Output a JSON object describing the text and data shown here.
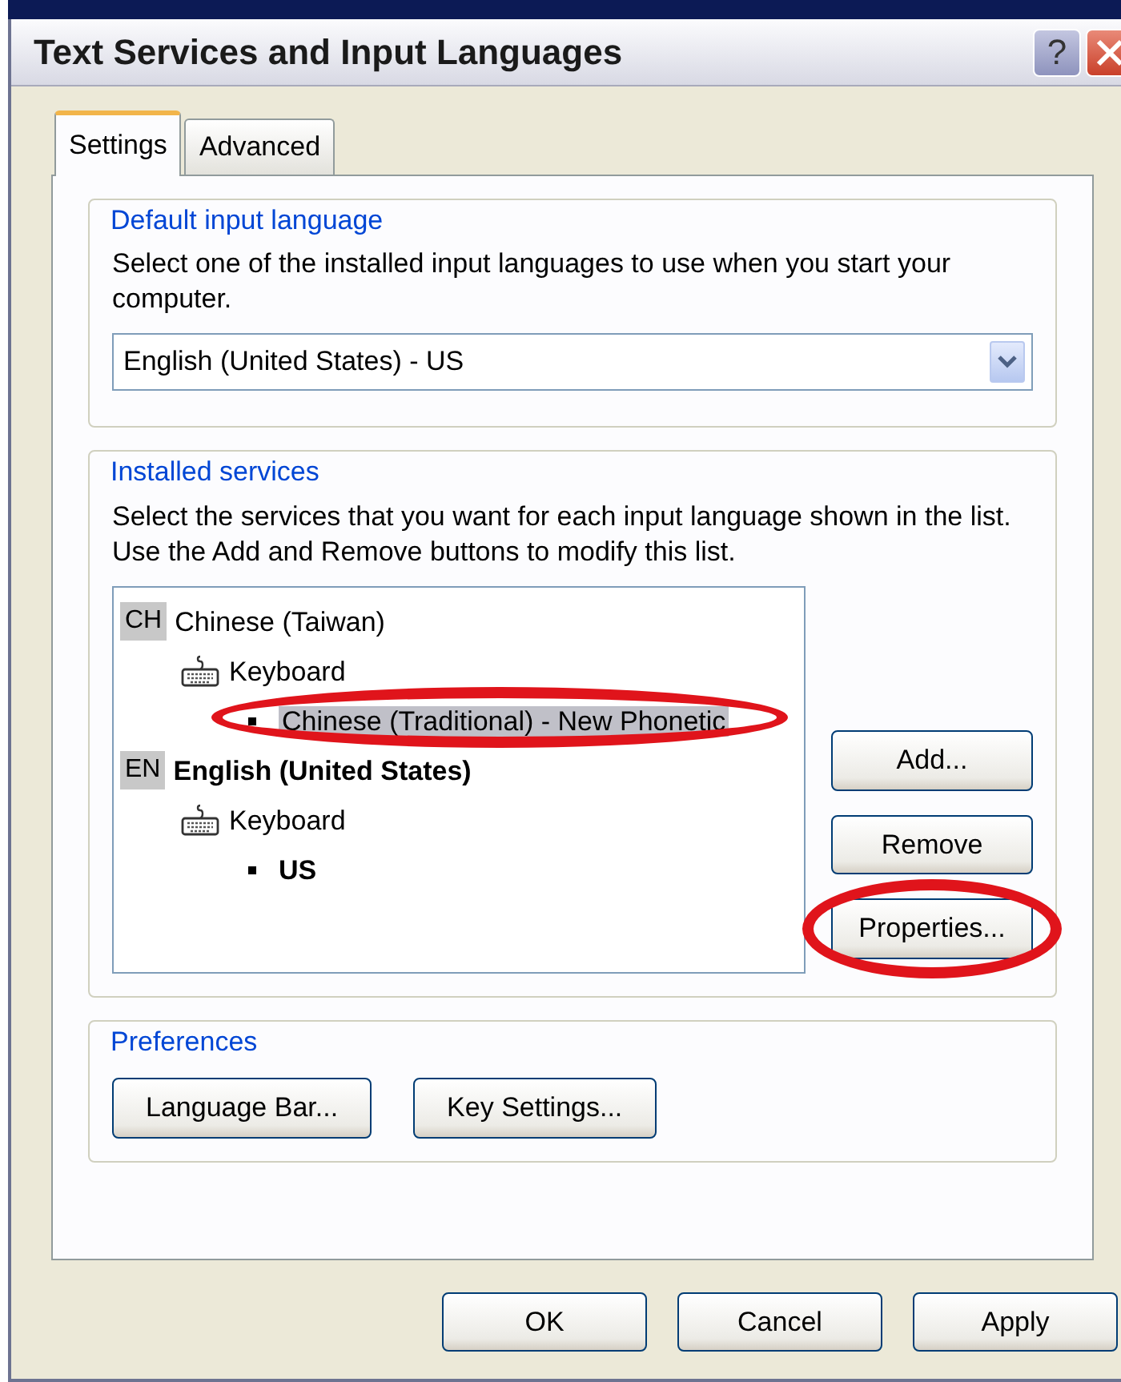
{
  "window": {
    "title": "Text Services and Input Languages",
    "title_buttons": [
      "?"
    ]
  },
  "tabs": [
    {
      "label": "Settings",
      "selected": true
    },
    {
      "label": "Advanced",
      "selected": false
    }
  ],
  "default_language": {
    "legend": "Default input language",
    "description": "Select one of the installed input languages to use when you start your computer.",
    "value": "English (United States) - US"
  },
  "installed_services": {
    "legend": "Installed services",
    "description": "Select the services that you want for each input language shown in the list. Use the Add and Remove buttons to modify this list.",
    "tree": [
      {
        "code": "CH",
        "label": "Chinese (Taiwan)",
        "default": false,
        "children": [
          {
            "label": "Keyboard",
            "children": [
              {
                "label": "Chinese (Traditional) - New Phonetic",
                "selected": true,
                "circled": true,
                "default": false
              }
            ]
          }
        ]
      },
      {
        "code": "EN",
        "label": "English (United States)",
        "default": true,
        "children": [
          {
            "label": "Keyboard",
            "children": [
              {
                "label": "US",
                "selected": false,
                "circled": false,
                "default": true
              }
            ]
          }
        ]
      }
    ],
    "buttons": [
      {
        "label": "Add...",
        "circled": false
      },
      {
        "label": "Remove",
        "circled": false
      },
      {
        "label": "Properties...",
        "circled": true
      }
    ]
  },
  "preferences": {
    "legend": "Preferences",
    "buttons": [
      "Language Bar...",
      "Key Settings..."
    ]
  },
  "dialog_buttons": [
    "OK",
    "Cancel",
    "Apply"
  ]
}
